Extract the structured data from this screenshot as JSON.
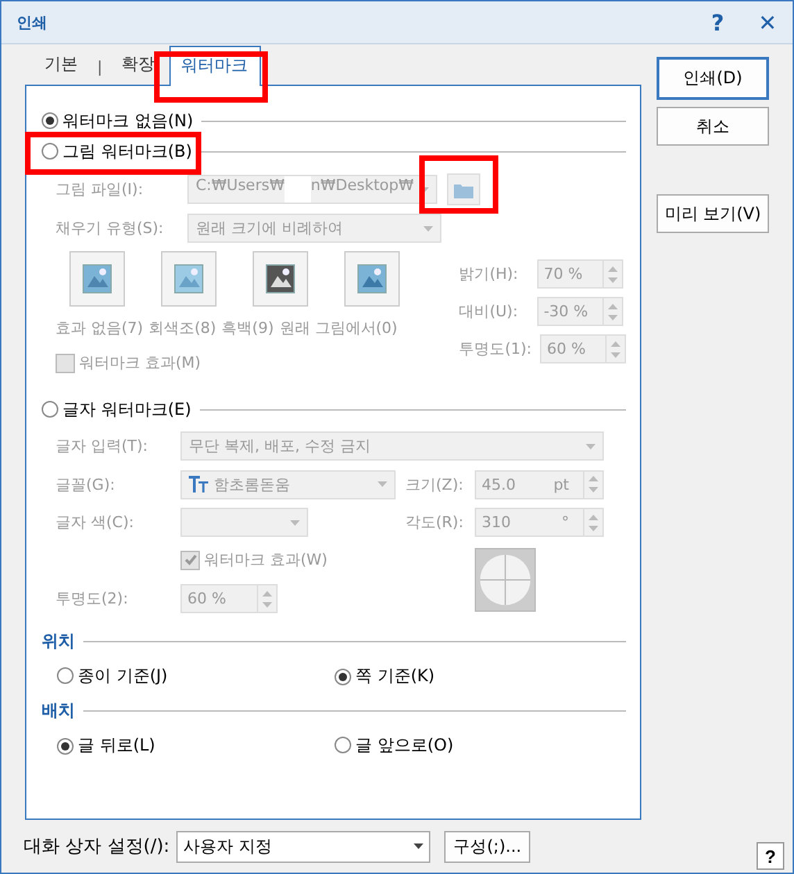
{
  "window": {
    "title": "인쇄",
    "help_glyph": "?",
    "close_glyph": "✕"
  },
  "tabs": [
    {
      "label": "기본",
      "selected": false
    },
    {
      "label": "확장",
      "selected": false
    },
    {
      "label": "워터마크",
      "selected": true
    }
  ],
  "tab_separator": "|",
  "no_watermark": {
    "label": "워터마크 없음(N)",
    "selected": true
  },
  "picture_watermark": {
    "label": "그림 워터마크(B)",
    "selected": false,
    "disabled": true,
    "file_label": "그림 파일(I):",
    "file_path": [
      "C:₩Users₩",
      "n₩Desktop₩"
    ],
    "fill_label": "채우기 유형(S):",
    "fill_value": "원래 크기에 비례하여",
    "effects": [
      {
        "kind": "none",
        "label": "효과 없음(7)"
      },
      {
        "kind": "gray",
        "label": "회색조(8)"
      },
      {
        "kind": "bw",
        "label": "흑백(9)"
      },
      {
        "kind": "original",
        "label": "원래 그림에서(0)"
      }
    ],
    "adjustments": [
      {
        "label": "밝기(H):",
        "value": "70 %"
      },
      {
        "label": "대비(U):",
        "value": "-30 %"
      },
      {
        "label": "투명도(1):",
        "value": "60 %"
      }
    ],
    "effect_checkbox": {
      "label": "워터마크 효과(M)",
      "checked": false
    }
  },
  "text_watermark": {
    "label": "글자 워터마크(E)",
    "selected": false,
    "disabled": true,
    "text_label": "글자 입력(T):",
    "text_value": "무단 복제, 배포, 수정 금지",
    "font_label": "글꼴(G):",
    "font_value": "함초롬돋움",
    "size_label": "크기(Z):",
    "size_value": "45.0",
    "size_unit": "pt",
    "color_label": "글자 색(C):",
    "angle_label": "각도(R):",
    "angle_value": "310",
    "angle_unit": "°",
    "effect_checkbox": {
      "label": "워터마크 효과(W)",
      "checked": true
    },
    "opacity_label": "투명도(2):",
    "opacity_value": "60 %"
  },
  "position": {
    "title": "위치",
    "options": [
      {
        "label": "종이 기준(J)",
        "selected": false
      },
      {
        "label": "쪽 기준(K)",
        "selected": true
      }
    ]
  },
  "placement": {
    "title": "배치",
    "options": [
      {
        "label": "글 뒤로(L)",
        "selected": true
      },
      {
        "label": "글 앞으로(O)",
        "selected": false
      }
    ]
  },
  "side_buttons": [
    {
      "label": "인쇄(D)",
      "default": true
    },
    {
      "label": "취소",
      "default": false
    },
    {
      "label": "미리 보기(V)",
      "default": false
    }
  ],
  "footer": {
    "label": "대화 상자 설정(/):",
    "value": "사용자 지정",
    "button": "구성(;)...",
    "help": "?"
  },
  "highlights": [
    {
      "kind": "tab"
    },
    {
      "kind": "picture-radio"
    },
    {
      "kind": "file-button"
    }
  ]
}
